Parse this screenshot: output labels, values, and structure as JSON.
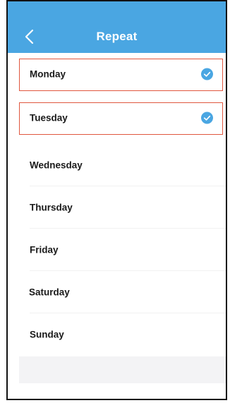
{
  "header": {
    "title": "Repeat",
    "back_icon": "chevron-left-icon",
    "color": "#4aa6e2"
  },
  "days": [
    {
      "label": "Monday",
      "selected": true
    },
    {
      "label": "Tuesday",
      "selected": true
    },
    {
      "label": "Wednesday",
      "selected": false
    },
    {
      "label": "Thursday",
      "selected": false
    },
    {
      "label": "Friday",
      "selected": false
    },
    {
      "label": "Saturday",
      "selected": false
    },
    {
      "label": "Sunday",
      "selected": false
    }
  ],
  "colors": {
    "selected_frame": "#e0573f",
    "check": "#4aa6e2"
  },
  "icons": {
    "selected": "check-circle-icon"
  }
}
